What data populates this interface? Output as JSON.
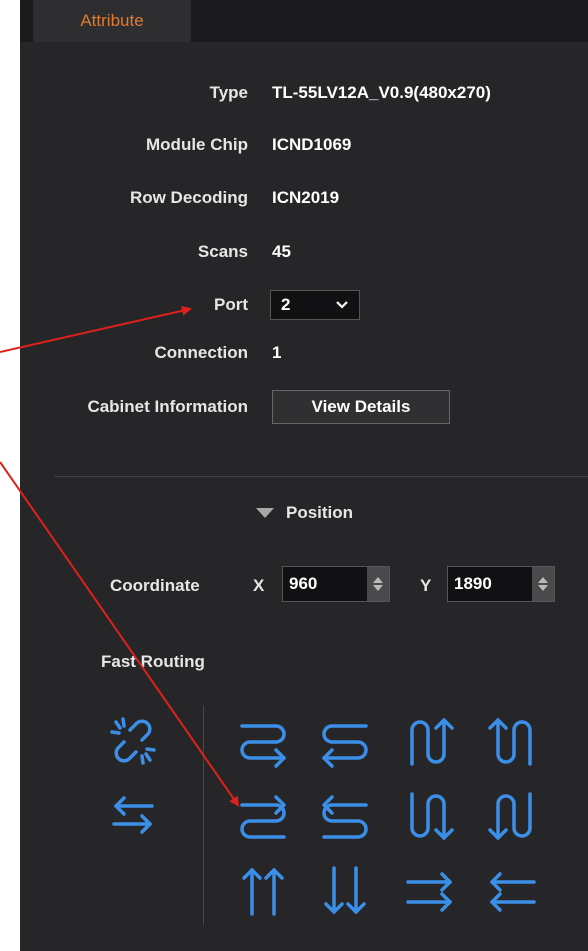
{
  "tab": {
    "label": "Attribute"
  },
  "attributes": {
    "type_label": "Type",
    "type_value": "TL-55LV12A_V0.9(480x270)",
    "chip_label": "Module Chip",
    "chip_value": "ICND1069",
    "row_label": "Row Decoding",
    "row_value": "ICN2019",
    "scans_label": "Scans",
    "scans_value": "45",
    "port_label": "Port",
    "port_value": "2",
    "connection_label": "Connection",
    "connection_value": "1",
    "cabinet_label": "Cabinet Information",
    "cabinet_button": "View Details"
  },
  "position": {
    "header": "Position",
    "coordinate_label": "Coordinate",
    "x_label": "X",
    "x_value": "960",
    "y_label": "Y",
    "y_value": "1890"
  },
  "fast_routing": {
    "label": "Fast Routing",
    "left_icons": [
      "unlink-icon",
      "swap-horizontal-icon"
    ],
    "grid_icons": [
      "snake-right-top-icon",
      "snake-left-top-icon",
      "snake-up-left-icon",
      "snake-up-right-icon",
      "snake-right-bottom-icon",
      "snake-left-bottom-icon",
      "snake-down-left-icon",
      "snake-down-right-icon",
      "parallel-up-icon",
      "parallel-down-icon",
      "parallel-right-icon",
      "parallel-left-icon"
    ]
  },
  "colors": {
    "accent": "#e07a2c",
    "icon": "#3b8fe8",
    "annotation": "#e0201a",
    "panel": "#262628"
  }
}
